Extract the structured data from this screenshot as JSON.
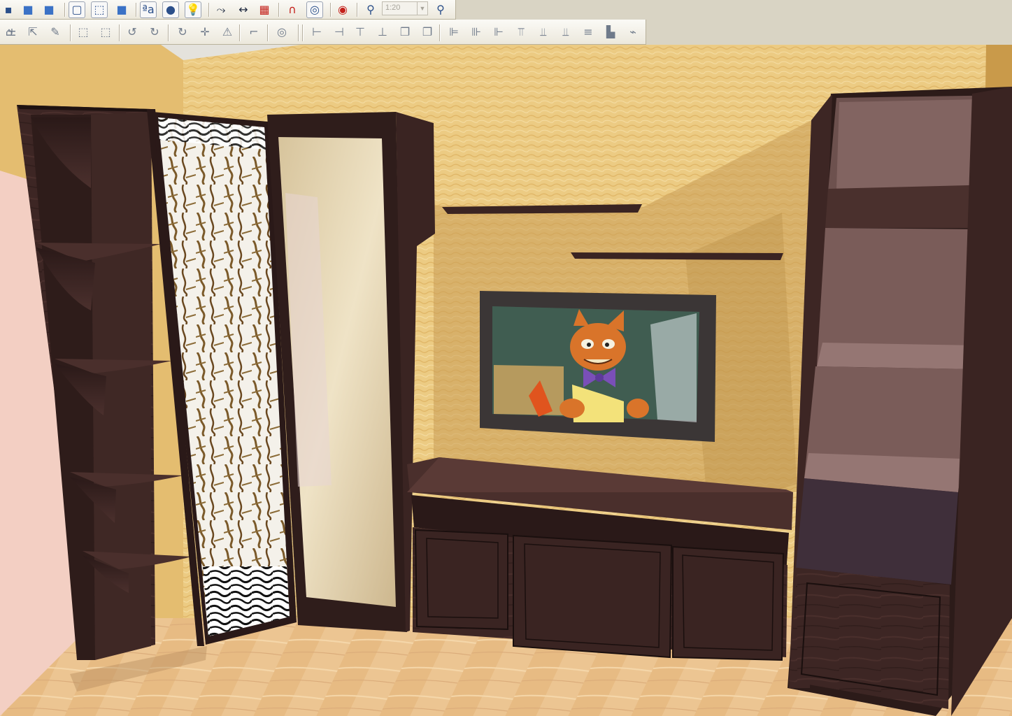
{
  "toolbar_top": {
    "buttons": [
      {
        "name": "view-3d-back-button",
        "glyph": "▪"
      },
      {
        "name": "view-cube-blue-button",
        "glyph": "■"
      },
      {
        "name": "view-cube-shaded-button",
        "glyph": "■"
      },
      {
        "name": "view-wireframe-button",
        "glyph": "▢"
      },
      {
        "name": "view-box-outline-button",
        "glyph": "⬚"
      },
      {
        "name": "view-box-solid-button",
        "glyph": "■"
      },
      {
        "name": "text-labels-button",
        "glyph": "ªa"
      },
      {
        "name": "materials-button",
        "glyph": "●"
      },
      {
        "name": "lighting-button",
        "glyph": "💡"
      },
      {
        "name": "tool-select-button",
        "glyph": "⤳"
      },
      {
        "name": "dimension-button",
        "glyph": "↔"
      },
      {
        "name": "grid-button",
        "glyph": "▦"
      },
      {
        "name": "magnet-button",
        "glyph": "∩"
      },
      {
        "name": "lifebuoy-button",
        "glyph": "◎"
      },
      {
        "name": "help-button",
        "glyph": "◉"
      },
      {
        "name": "zoom-in-button",
        "glyph": "⚲"
      },
      {
        "name": "zoom-out-button",
        "glyph": "⚲"
      }
    ],
    "zoom_value": "1:20"
  },
  "toolbar_bottom": {
    "buttons": [
      {
        "name": "insert-panel-button",
        "glyph": "±"
      },
      {
        "name": "move-pointer-button",
        "glyph": "⇱"
      },
      {
        "name": "edit-pencil-button",
        "glyph": "✎"
      },
      {
        "name": "select-frame-button",
        "glyph": "⬚"
      },
      {
        "name": "select-group-button",
        "glyph": "⬚"
      },
      {
        "name": "rotate-left-button",
        "glyph": "↺"
      },
      {
        "name": "rotate-right-button",
        "glyph": "↻"
      },
      {
        "name": "rotate-button",
        "glyph": "↻"
      },
      {
        "name": "move-cross-button",
        "glyph": "✛"
      },
      {
        "name": "warning-button",
        "glyph": "⚠"
      },
      {
        "name": "profile-button",
        "glyph": "⌐"
      },
      {
        "name": "target-button",
        "glyph": "◎"
      },
      {
        "name": "align-left-button",
        "glyph": "⊢"
      },
      {
        "name": "align-right-button",
        "glyph": "⊣"
      },
      {
        "name": "align-top-button",
        "glyph": "⊤"
      },
      {
        "name": "align-bottom-button",
        "glyph": "⊥"
      },
      {
        "name": "copy-button",
        "glyph": "❐"
      },
      {
        "name": "mirror-button",
        "glyph": "❐"
      },
      {
        "name": "distribute-left-button",
        "glyph": "⊫"
      },
      {
        "name": "distribute-center-button",
        "glyph": "⊪"
      },
      {
        "name": "distribute-right-button",
        "glyph": "⊩"
      },
      {
        "name": "distribute-top-button",
        "glyph": "⫪"
      },
      {
        "name": "distribute-vertical-button",
        "glyph": "⫫"
      },
      {
        "name": "distribute-bottom-button",
        "glyph": "⫫"
      },
      {
        "name": "spacing-button",
        "glyph": "≡"
      },
      {
        "name": "chart-button",
        "glyph": "▙"
      },
      {
        "name": "hinge-button",
        "glyph": "⌁"
      },
      {
        "name": "handle-button",
        "glyph": "⌂"
      }
    ]
  },
  "scene": {
    "colors": {
      "wall": "#e9c57a",
      "wall_light": "#f2d595",
      "floor": "#e6bf8a",
      "wenge": "#3b2523",
      "wenge_dark": "#251615",
      "wenge_light": "#5a3a36",
      "frame_line": "#1a0f0e"
    }
  }
}
